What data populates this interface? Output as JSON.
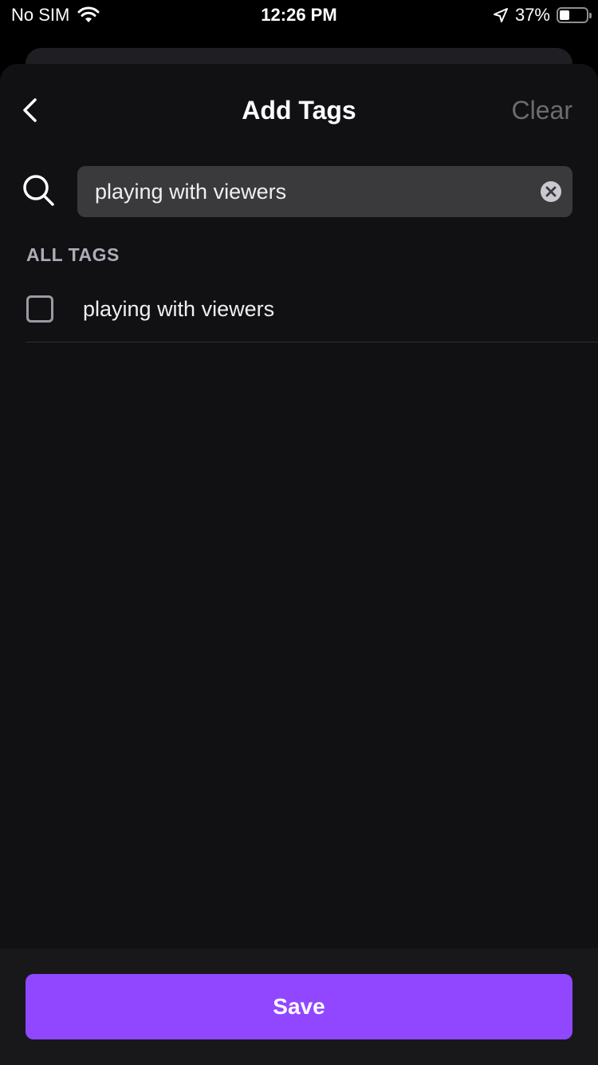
{
  "status_bar": {
    "carrier": "No SIM",
    "time": "12:26 PM",
    "battery_percent": "37%",
    "battery_level": 0.37,
    "icons": [
      "wifi-icon",
      "location-arrow-icon",
      "battery-icon"
    ]
  },
  "nav": {
    "title": "Add Tags",
    "clear_label": "Clear",
    "back_icon": "chevron-left-icon"
  },
  "search": {
    "value": "playing with viewers",
    "placeholder": "",
    "icon": "search-icon",
    "clear_icon": "clear-circle-icon"
  },
  "section": {
    "header": "ALL TAGS"
  },
  "tags": [
    {
      "label": "playing with viewers",
      "checked": false
    }
  ],
  "footer": {
    "save_label": "Save"
  },
  "colors": {
    "accent": "#9147ff",
    "sheet_background": "#111114",
    "field_background": "#3a3a3d",
    "muted_text": "#6b6b70"
  }
}
